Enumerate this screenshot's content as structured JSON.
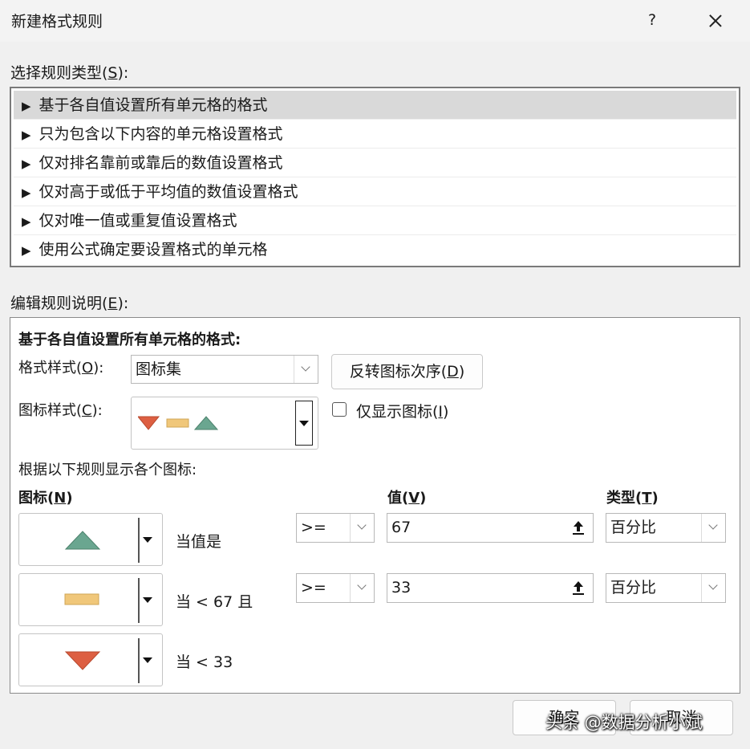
{
  "dialog": {
    "title": "新建格式规则",
    "help": "?"
  },
  "rule_type": {
    "label_pre": "选择规则类型(",
    "label_key": "S",
    "label_post": "):",
    "items": [
      {
        "label": "基于各自值设置所有单元格的格式",
        "selected": true
      },
      {
        "label": "只为包含以下内容的单元格设置格式",
        "selected": false
      },
      {
        "label": "仅对排名靠前或靠后的数值设置格式",
        "selected": false
      },
      {
        "label": "仅对高于或低于平均值的数值设置格式",
        "selected": false
      },
      {
        "label": "仅对唯一值或重复值设置格式",
        "selected": false
      },
      {
        "label": "使用公式确定要设置格式的单元格",
        "selected": false
      }
    ],
    "arrow_glyph": "▶"
  },
  "edit": {
    "label_pre": "编辑规则说明(",
    "label_key": "E",
    "label_post": "):",
    "heading": "基于各自值设置所有单元格的格式:",
    "format_style_pre": "格式样式(",
    "format_style_key": "O",
    "format_style_post": "):",
    "format_style_value": "图标集",
    "reverse_pre": "反转图标次序(",
    "reverse_key": "D",
    "reverse_post": ")",
    "icon_style_pre": "图标样式(",
    "icon_style_key": "C",
    "icon_style_post": "):",
    "show_icon_only_pre": "仅显示图标(",
    "show_icon_only_key": "I",
    "show_icon_only_post": ")",
    "show_icon_only_checked": false,
    "rules_caption": "根据以下规则显示各个图标:",
    "col_icon_pre": "图标(",
    "col_icon_key": "N",
    "col_icon_post": ")",
    "col_value_pre": "值(",
    "col_value_key": "V",
    "col_value_post": ")",
    "col_type_pre": "类型(",
    "col_type_key": "T",
    "col_type_post": ")",
    "rows": [
      {
        "icon": "green-up-triangle-icon",
        "condition": "当值是",
        "operator": ">=",
        "value": "67",
        "type": "百分比"
      },
      {
        "icon": "yellow-bar-icon",
        "condition": "当 < 67 且",
        "operator": ">=",
        "value": "33",
        "type": "百分比"
      },
      {
        "icon": "red-down-triangle-icon",
        "condition": "当 < 33"
      }
    ]
  },
  "footer": {
    "ok_label": "确定",
    "cancel_label": "取消"
  },
  "watermark": "头条 @数据分析小斌",
  "colors": {
    "green": "#6aa690",
    "yellow": "#f0c77a",
    "red": "#dd5f42",
    "selected": "#d9d9d9"
  }
}
